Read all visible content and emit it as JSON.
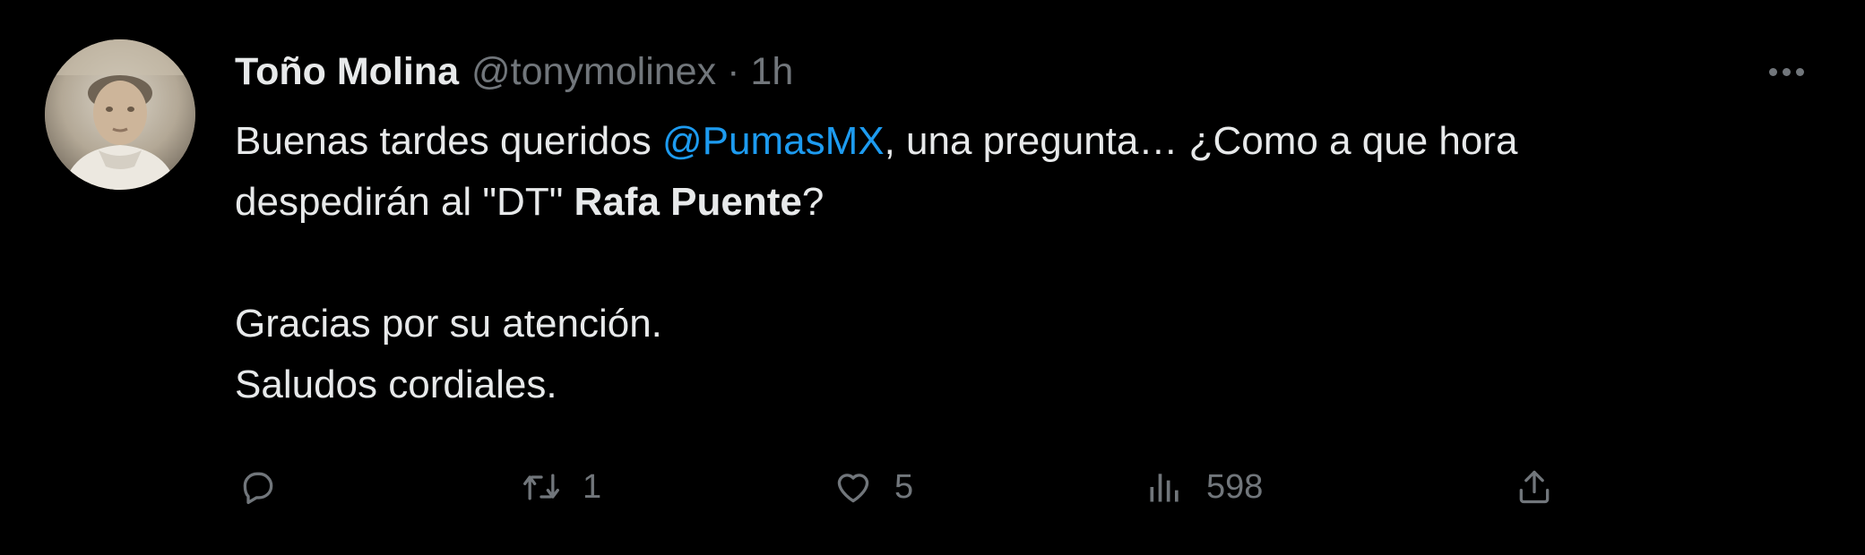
{
  "tweet": {
    "author": {
      "display_name": "Toño Molina",
      "handle": "@tonymolinex",
      "separator": "·",
      "time": "1h"
    },
    "text": {
      "line1_before": "Buenas tardes queridos ",
      "mention": "@PumasMX",
      "line1_after": ", una pregunta… ¿Como a que hora",
      "line2_before": "despedirán al \"DT\" ",
      "line2_bold": "Rafa Puente",
      "line2_after": "?",
      "line3": "Gracias por su atención.",
      "line4": "Saludos cordiales."
    },
    "actions": {
      "replies": "",
      "retweets": "1",
      "likes": "5",
      "views": "598"
    }
  },
  "colors": {
    "background": "#000000",
    "text": "#e7e9ea",
    "secondary": "#71767b",
    "link": "#1d9bf0"
  },
  "icons": {
    "reply": "reply-icon",
    "retweet": "retweet-icon",
    "like": "heart-icon",
    "views": "views-icon",
    "share": "share-icon",
    "more": "more-icon"
  }
}
